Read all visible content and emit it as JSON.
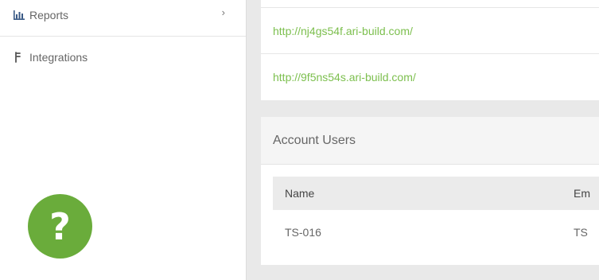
{
  "sidebar": {
    "items": [
      {
        "label": "Reports",
        "icon": "bar-chart-icon",
        "chevron": "›"
      },
      {
        "label": "Integrations",
        "icon": "plug-icon"
      }
    ],
    "help_glyph": "?"
  },
  "main": {
    "links": [
      "http://nj4gs54f.ari-build.com/",
      "http://9f5ns54s.ari-build.com/"
    ],
    "account_users": {
      "title": "Account Users",
      "columns": [
        "Name",
        "Em"
      ],
      "rows": [
        [
          "TS-016",
          "TS"
        ]
      ]
    }
  },
  "colors": {
    "accent_green": "#6aac3b",
    "link_green": "#7cbf4e",
    "background": "#e9e9e9"
  }
}
